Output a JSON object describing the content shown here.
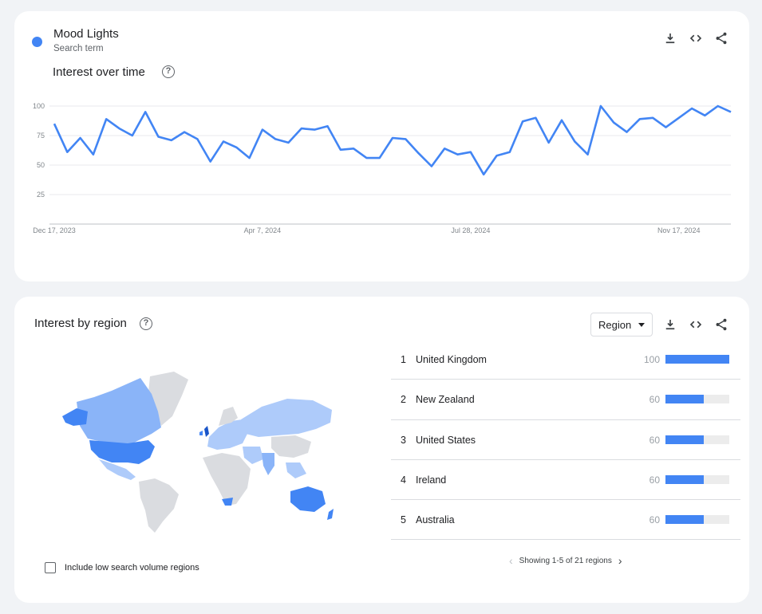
{
  "term": {
    "name": "Mood Lights",
    "sub": "Search term",
    "color": "#4285f4"
  },
  "time_section": {
    "title": "Interest over time",
    "help": "?",
    "icons": [
      "download-icon",
      "embed-code-icon",
      "share-icon"
    ]
  },
  "chart_data": {
    "type": "line",
    "title": "",
    "xlabel": "",
    "ylabel": "",
    "ylim": [
      0,
      100
    ],
    "yticks": [
      "100",
      "75",
      "50",
      "25"
    ],
    "xticks": [
      "Dec 17, 2023",
      "Apr 7, 2024",
      "Jul 28, 2024",
      "Nov 17, 2024"
    ],
    "grid": true,
    "series": [
      {
        "color": "#4285f4",
        "values": [
          85,
          61,
          73,
          59,
          89,
          81,
          75,
          95,
          74,
          71,
          78,
          72,
          53,
          70,
          65,
          56,
          80,
          72,
          69,
          81,
          80,
          83,
          63,
          64,
          56,
          56,
          73,
          72,
          60,
          49,
          64,
          59,
          61,
          42,
          58,
          61,
          87,
          90,
          69,
          88,
          70,
          59,
          100,
          86,
          78,
          89,
          90,
          82,
          90,
          98,
          92,
          100,
          95
        ]
      }
    ]
  },
  "region_section": {
    "title": "Interest by region",
    "help": "?",
    "select_label": "Region",
    "icons": [
      "download-icon",
      "embed-code-icon",
      "share-icon"
    ],
    "low_volume_label": "Include low search volume regions",
    "low_volume_checked": false,
    "pager_text": "Showing 1-5 of 21 regions",
    "ranks": [
      {
        "rank": "1",
        "name": "United Kingdom",
        "value": "100",
        "fill": 1.0
      },
      {
        "rank": "2",
        "name": "New Zealand",
        "value": "60",
        "fill": 0.6
      },
      {
        "rank": "3",
        "name": "United States",
        "value": "60",
        "fill": 0.6
      },
      {
        "rank": "4",
        "name": "Ireland",
        "value": "60",
        "fill": 0.6
      },
      {
        "rank": "5",
        "name": "Australia",
        "value": "60",
        "fill": 0.6
      }
    ],
    "map_colors": {
      "high": "#4285f4",
      "mid": "#8ab4f8",
      "low": "#aecbfa",
      "none": "#dadce0"
    }
  }
}
